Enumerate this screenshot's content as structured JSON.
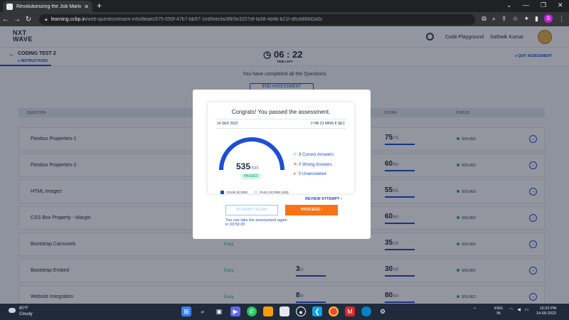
{
  "browser": {
    "tab_title": "Revolutionizing the Job Market |",
    "url_host": "learning.ccbp.in",
    "url_path": "/web-question/exam-info/8eaec575-050f-47b7-bb97-1ed0eecfa3f8/5e3207df-fa38-4d4b-b21f-d6cb86fd2a0c",
    "profile_initial": "S"
  },
  "header": {
    "logo_line1": "NXT",
    "logo_line2": "WAVE",
    "code_playground": "Code Playground",
    "user_name": "Sathwik Kumar"
  },
  "test": {
    "name": "CODING TEST 2",
    "instructions_tab": "INSTRUCTIONS",
    "timer": "06 : 22",
    "time_left_label": "TIME LEFT",
    "quit_label": "QUIT ASSESSMENT",
    "completed_msg": "You have completed all the Questions",
    "end_button": "END ASSESSMENT"
  },
  "table": {
    "headers": {
      "question": "QUESTION",
      "score": "SCORE",
      "status": "STATUS"
    },
    "rows": [
      {
        "question": "Flexbox Properties-1",
        "difficulty": "",
        "num": "",
        "num_total": "",
        "score": "75",
        "score_total": "/75",
        "status": "SOLVED"
      },
      {
        "question": "Flexbox Properties-2",
        "difficulty": "",
        "num": "",
        "num_total": "",
        "score": "60",
        "score_total": "/60",
        "status": "SOLVED"
      },
      {
        "question": "HTML Images",
        "difficulty": "",
        "num": "",
        "num_total": "",
        "score": "55",
        "score_total": "/55",
        "status": "SOLVED"
      },
      {
        "question": "CSS Box Property - Margin",
        "difficulty": "",
        "num": "",
        "num_total": "",
        "score": "60",
        "score_total": "/60",
        "status": "SOLVED"
      },
      {
        "question": "Bootstrap Carousels",
        "difficulty": "Easy",
        "num": "",
        "num_total": "",
        "score": "35",
        "score_total": "/35",
        "status": "SOLVED"
      },
      {
        "question": "Bootstrap Embed",
        "difficulty": "Easy",
        "num": "3",
        "num_total": "/3",
        "score": "30",
        "score_total": "/30",
        "status": "SOLVED"
      },
      {
        "question": "Website Integration",
        "difficulty": "Easy",
        "num": "8",
        "num_total": "/8",
        "score": "80",
        "score_total": "/80",
        "status": "SOLVED"
      }
    ]
  },
  "modal": {
    "title": "Congrats! You passed the assessment.",
    "date": "14 SEP 2022",
    "duration": "2 HR 23 MINS 8 SEC",
    "score": "535",
    "score_total": "/535",
    "score_fraction": 1.0,
    "passed_label": "PASSED",
    "correct": "Correct Answers",
    "wrong": "Wrong Answers",
    "unanswered": "Unanswered",
    "correct_count": "9",
    "wrong_count": "0",
    "unanswered_count": "0",
    "your_score_label": "YOUR SCORE",
    "pass_score_label": "PASS SCORE (428)",
    "review_label": "REVIEW ATTEMPT",
    "attempt_again": "ATTEMPT AGAIN",
    "proceed": "PROCEED",
    "retake_note": "You can take the assessment again in 03:59:20",
    "colors": {
      "accent": "#1d4ed8",
      "proceed": "#f97316",
      "pass": "#10b981"
    }
  },
  "taskbar": {
    "temp": "80°F",
    "weather": "Cloudy",
    "lang1": "ENG",
    "lang2": "IN",
    "time": "10:23 PM",
    "date": "14-09-2022"
  }
}
